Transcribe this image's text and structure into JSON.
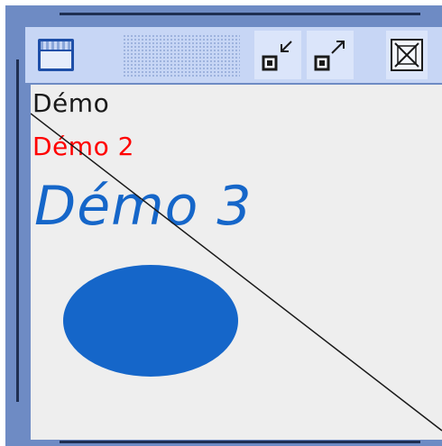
{
  "colors": {
    "frame": "#6e8bc4",
    "titlebar": "#c7d6f5",
    "text_black": "#1a1a1a",
    "text_red": "#ff0000",
    "text_blue": "#1566c9",
    "ellipse_blue": "#1566c9",
    "content_bg": "#eeeeee"
  },
  "titlebar": {
    "icons": [
      "window-menu-icon",
      "minimize-icon",
      "maximize-icon",
      "close-icon"
    ]
  },
  "content": {
    "text1": "Démo",
    "text2": "Démo 2",
    "text3": "Démo 3"
  }
}
